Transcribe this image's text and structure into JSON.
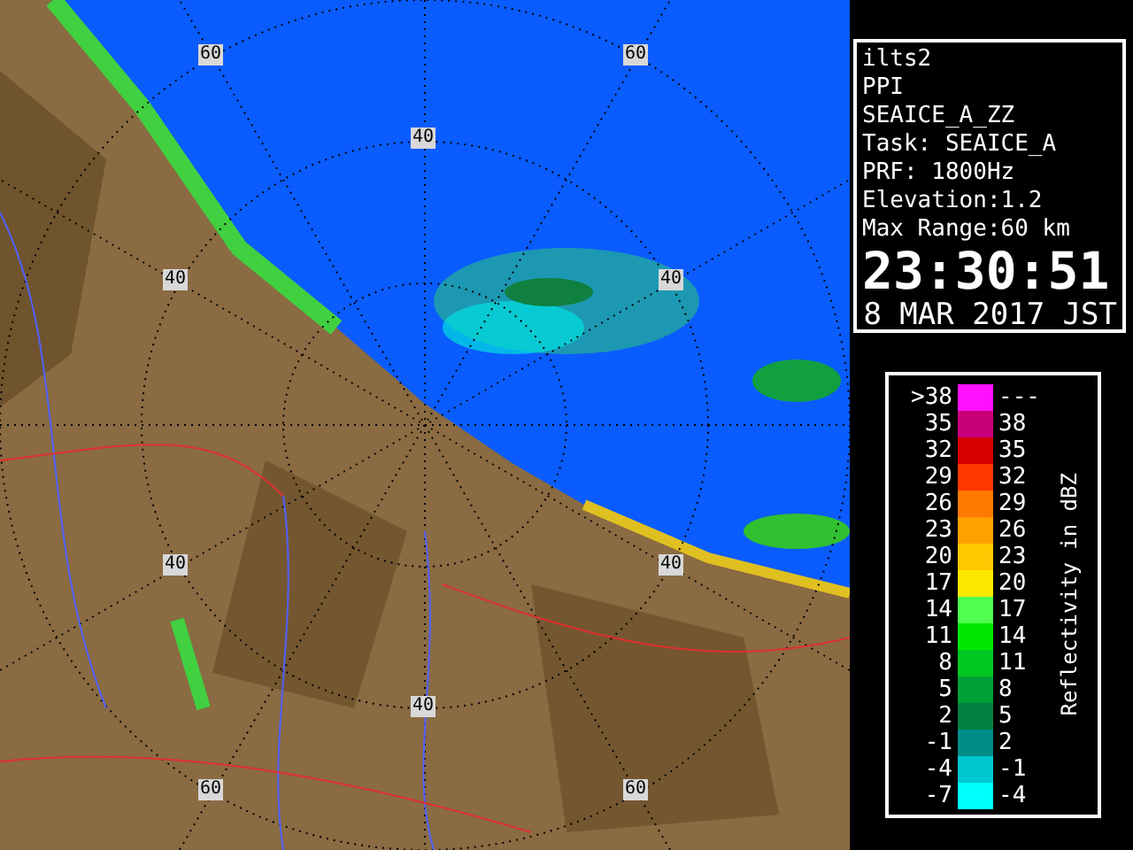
{
  "map": {
    "range_labels": [
      "60",
      "60",
      "40",
      "40",
      "40",
      "40",
      "40",
      "40",
      "60",
      "60"
    ]
  },
  "info": {
    "lines": [
      "ilts2",
      "PPI",
      "SEAICE_A_ZZ",
      "Task: SEAICE_A",
      "PRF: 1800Hz",
      "Elevation:1.2",
      "Max Range:60 km"
    ],
    "time": "23:30:51",
    "date": "8 MAR 2017 JST"
  },
  "legend": {
    "title": "Reflectivity in dBZ",
    "rows": [
      {
        "low": ">38",
        "high": "---",
        "color": "#ff10ff"
      },
      {
        "low": "35",
        "high": "38",
        "color": "#c8007a"
      },
      {
        "low": "32",
        "high": "35",
        "color": "#d80000"
      },
      {
        "low": "29",
        "high": "32",
        "color": "#ff3800"
      },
      {
        "low": "26",
        "high": "29",
        "color": "#ff7800"
      },
      {
        "low": "23",
        "high": "26",
        "color": "#ffa000"
      },
      {
        "low": "20",
        "high": "23",
        "color": "#ffc800"
      },
      {
        "low": "17",
        "high": "20",
        "color": "#ffe800"
      },
      {
        "low": "14",
        "high": "17",
        "color": "#50ff50"
      },
      {
        "low": "11",
        "high": "14",
        "color": "#00e800"
      },
      {
        "low": "8",
        "high": "11",
        "color": "#00c820"
      },
      {
        "low": "5",
        "high": "8",
        "color": "#00a038"
      },
      {
        "low": "2",
        "high": "5",
        "color": "#008040"
      },
      {
        "low": "-1",
        "high": "2",
        "color": "#008c88"
      },
      {
        "low": "-4",
        "high": "-1",
        "color": "#00c8d0"
      },
      {
        "low": "-7",
        "high": "-4",
        "color": "#00ffff"
      }
    ]
  }
}
